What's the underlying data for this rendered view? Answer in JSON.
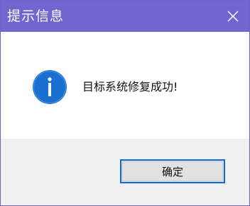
{
  "window": {
    "title": "提示信息",
    "close_icon": "close-icon"
  },
  "message": {
    "icon": "info-icon",
    "text": "目标系统修复成功!"
  },
  "footer": {
    "ok_label": "确定"
  },
  "colors": {
    "titlebar": "#6f66cf",
    "icon_blue": "#1a6fd0",
    "button_focus": "#0a6bd1",
    "footer_bg": "#f0f0f0"
  }
}
